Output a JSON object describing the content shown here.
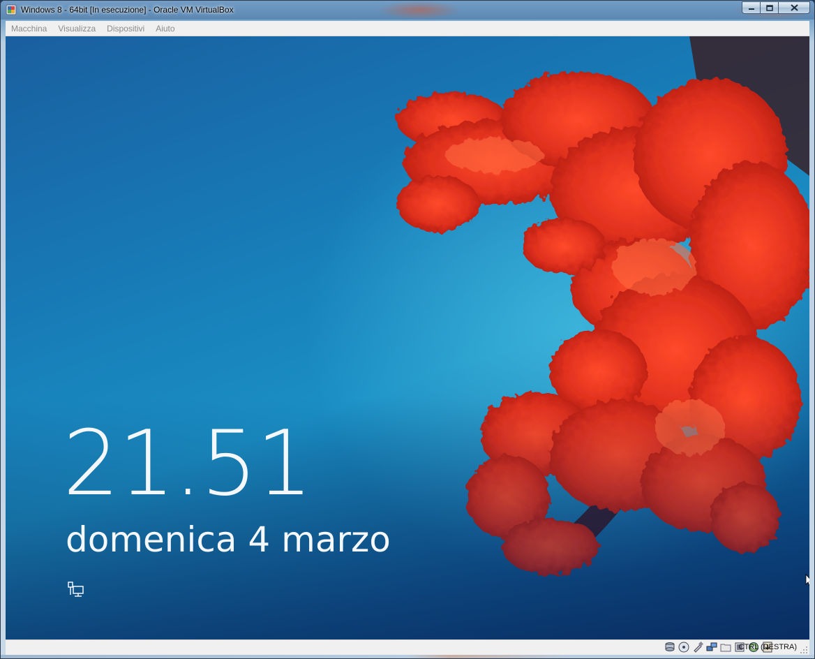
{
  "window": {
    "title": "Windows 8 - 64bit [In esecuzione] - Oracle VM VirtualBox",
    "controls": {
      "minimize_icon": "minimize-icon",
      "maximize_icon": "maximize-icon",
      "close_icon": "close-icon"
    }
  },
  "menu": {
    "items": [
      "Macchina",
      "Visualizza",
      "Dispositivi",
      "Aiuto"
    ]
  },
  "lockscreen": {
    "time": "21.51",
    "date": "domenica 4 marzo",
    "network_icon": "network-icon",
    "background": "coral-reef-underwater"
  },
  "statusbar": {
    "icons": [
      "hard-disk-icon",
      "optical-drive-icon",
      "usb-icon",
      "network-adapters-icon",
      "shared-folders-icon",
      "video-capture-icon",
      "virtualization-icon",
      "mouse-integration-icon"
    ],
    "host_key": "CTRL (DESTRA)"
  },
  "colors": {
    "clock_text": "#f4f7fb",
    "menu_text_disabled": "#8a8a8a",
    "screen_blue": "#1779b5",
    "coral_red": "#e0301e"
  }
}
